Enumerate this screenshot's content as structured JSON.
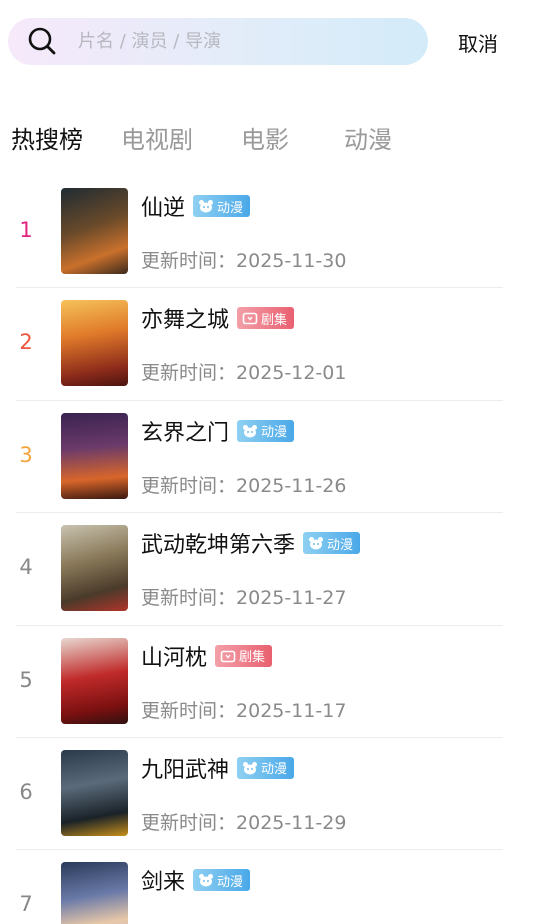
{
  "search": {
    "placeholder": "片名 / 演员 / 导演",
    "value": "",
    "cancel_label": "取消"
  },
  "tabs": [
    {
      "label": "热搜榜",
      "active": true
    },
    {
      "label": "电视剧",
      "active": false
    },
    {
      "label": "电影",
      "active": false
    },
    {
      "label": "动漫",
      "active": false
    }
  ],
  "colors": {
    "rank_1": "#e4247f",
    "rank_2": "#f0553d",
    "rank_3": "#f4a43c",
    "rank_default": "#888888",
    "badge_anime": "#4aa8e8",
    "badge_drama": "#e96070"
  },
  "update_prefix": "更新时间：",
  "items": [
    {
      "rank": "1",
      "title": "仙逆",
      "badge": "动漫",
      "badge_type": "anime",
      "badge_icon": "bear-icon",
      "date": "2025-11-30"
    },
    {
      "rank": "2",
      "title": "亦舞之城",
      "badge": "剧集",
      "badge_type": "drama",
      "badge_icon": "tv-icon",
      "date": "2025-12-01"
    },
    {
      "rank": "3",
      "title": "玄界之门",
      "badge": "动漫",
      "badge_type": "anime",
      "badge_icon": "bear-icon",
      "date": "2025-11-26"
    },
    {
      "rank": "4",
      "title": "武动乾坤第六季",
      "badge": "动漫",
      "badge_type": "anime",
      "badge_icon": "bear-icon",
      "date": "2025-11-27"
    },
    {
      "rank": "5",
      "title": "山河枕",
      "badge": "剧集",
      "badge_type": "drama",
      "badge_icon": "tv-icon",
      "date": "2025-11-17"
    },
    {
      "rank": "6",
      "title": "九阳武神",
      "badge": "动漫",
      "badge_type": "anime",
      "badge_icon": "bear-icon",
      "date": "2025-11-29"
    },
    {
      "rank": "7",
      "title": "剑来",
      "badge": "动漫",
      "badge_type": "anime",
      "badge_icon": "bear-icon",
      "date": ""
    }
  ]
}
